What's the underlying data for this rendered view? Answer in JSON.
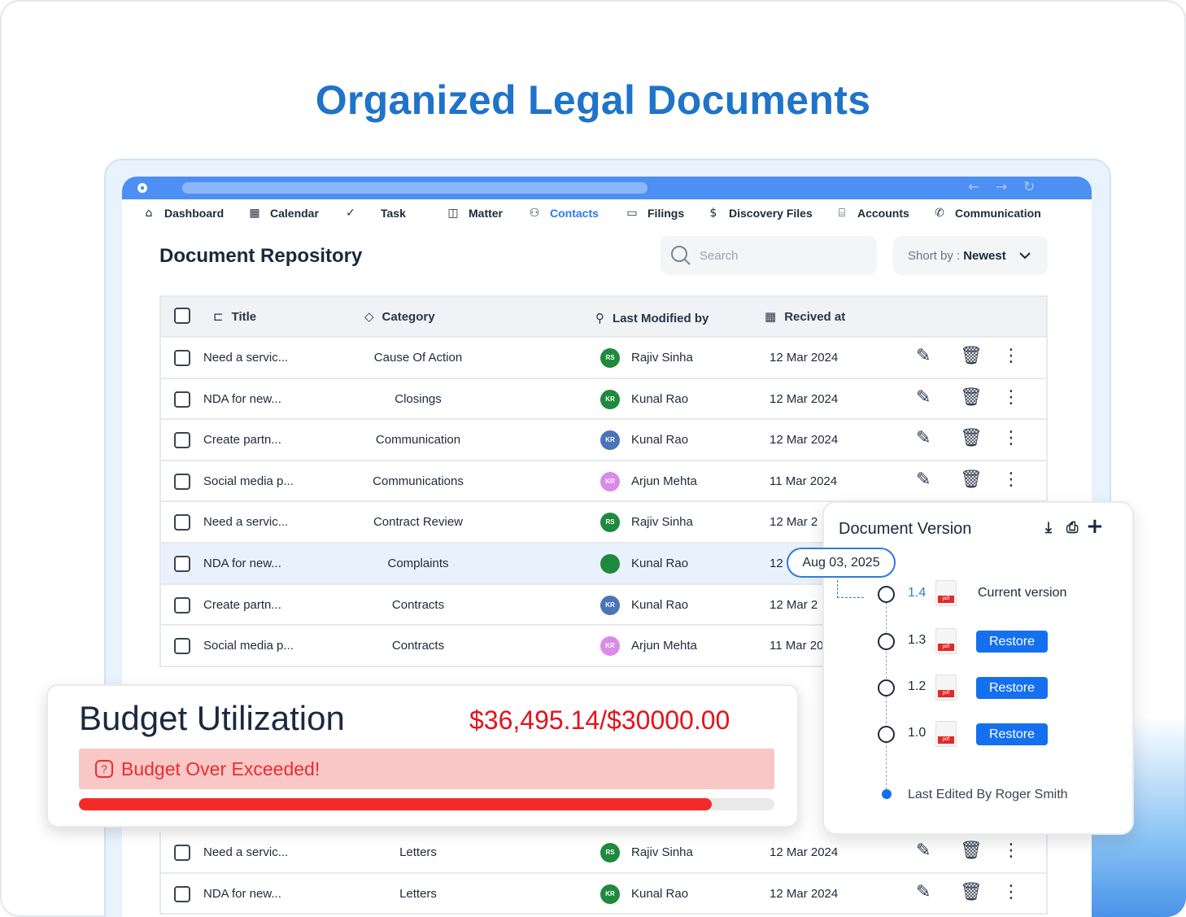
{
  "headline": "Organized Legal Documents",
  "nav": {
    "items": [
      {
        "label": "Dashboard",
        "icon": "home-icon"
      },
      {
        "label": "Calendar",
        "icon": "calendar-icon"
      },
      {
        "label": "Task",
        "icon": "task-check-icon"
      },
      {
        "label": "Matter",
        "icon": "briefcase-icon"
      },
      {
        "label": "Contacts",
        "icon": "users-icon",
        "active": true
      },
      {
        "label": "Filings",
        "icon": "folder-icon"
      },
      {
        "label": "Discovery Files",
        "icon": "dollar-icon"
      },
      {
        "label": "Accounts",
        "icon": "bank-icon"
      },
      {
        "label": "Communication",
        "icon": "phone-icon"
      }
    ]
  },
  "repository": {
    "title": "Document Repository",
    "search_placeholder": "Search",
    "sort_prefix": "Short by :",
    "sort_value": "Newest"
  },
  "table": {
    "headers": {
      "title": "Title",
      "category": "Category",
      "modified": "Last Modified by",
      "received": "Recived at"
    },
    "rows": [
      {
        "title": "Need a servic...",
        "category": "Cause Of Action",
        "initials": "RS",
        "color": "#1e8a3e",
        "user": "Rajiv Sinha",
        "date": "12 Mar 2024"
      },
      {
        "title": "NDA for new...",
        "category": "Closings",
        "initials": "KR",
        "color": "#1e8a3e",
        "user": "Kunal Rao",
        "date": "12 Mar 2024"
      },
      {
        "title": "Create partn...",
        "category": "Communication",
        "initials": "KR",
        "color": "#4a74b8",
        "user": "Kunal Rao",
        "date": "12 Mar 2024"
      },
      {
        "title": "Social media p...",
        "category": "Communications",
        "initials": "KR",
        "color": "#d88be8",
        "user": "Arjun Mehta",
        "date": "11 Mar 2024"
      },
      {
        "title": "Need a servic...",
        "category": "Contract Review",
        "initials": "RS",
        "color": "#1e8a3e",
        "user": "Rajiv Sinha",
        "date": "12 Mar 2"
      },
      {
        "title": "NDA for new...",
        "category": "Complaints",
        "initials": "",
        "color": "#1e8a3e",
        "user": "Kunal Rao",
        "date": "12"
      },
      {
        "title": "Create partn...",
        "category": "Contracts",
        "initials": "KR",
        "color": "#4a74b8",
        "user": "Kunal Rao",
        "date": "12 Mar 2"
      },
      {
        "title": "Social media p...",
        "category": "Contracts",
        "initials": "KR",
        "color": "#d88be8",
        "user": "Arjun Mehta",
        "date": "11 Mar 20"
      }
    ],
    "bottom_rows": [
      {
        "title": "Need a servic...",
        "category": "Letters",
        "initials": "RS",
        "color": "#1e8a3e",
        "user": "Rajiv Sinha",
        "date": "12 Mar 2024"
      },
      {
        "title": "NDA for new...",
        "category": "Letters",
        "initials": "KR",
        "color": "#1e8a3e",
        "user": "Kunal Rao",
        "date": "12 Mar 2024"
      }
    ]
  },
  "budget": {
    "title": "Budget Utilization",
    "amount": "$36,495.14/$30000.00",
    "alert": "Budget Over Exceeded!",
    "progress_fraction": 0.91,
    "color": "#f42a2a"
  },
  "version_panel": {
    "title": "Document Version",
    "date": "Aug 03, 2025",
    "versions": [
      {
        "num": "1.4",
        "current_label": "Current version"
      },
      {
        "num": "1.3",
        "restore": "Restore"
      },
      {
        "num": "1.2",
        "restore": "Restore"
      },
      {
        "num": "1.0",
        "restore": "Restore"
      }
    ],
    "last_edited": "Last Edited By Roger Smith"
  }
}
